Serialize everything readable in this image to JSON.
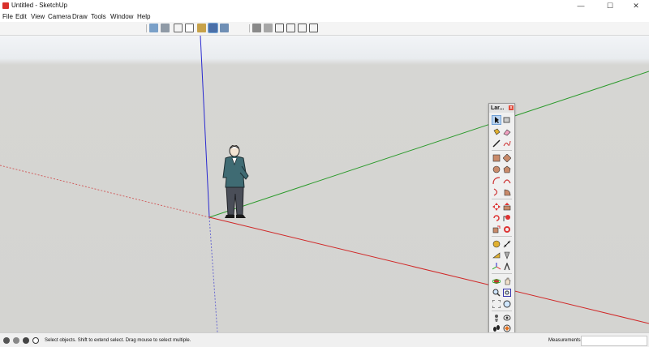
{
  "window": {
    "title": "Untitled - SketchUp",
    "controls": {
      "minimize": "—",
      "maximize": "☐",
      "close": "✕"
    }
  },
  "menu": [
    "File",
    "Edit",
    "View",
    "Camera",
    "Draw",
    "Tools",
    "Window",
    "Help"
  ],
  "toolbar": {
    "view_buttons": [
      {
        "icon": "iso-view-icon"
      },
      {
        "icon": "top-view-icon"
      },
      {
        "icon": "front-view-icon"
      },
      {
        "icon": "right-view-icon"
      },
      {
        "icon": "back-view-icon"
      },
      {
        "icon": "left-view-icon"
      }
    ],
    "style_buttons": [
      {
        "icon": "xray-style-icon"
      },
      {
        "icon": "back-edges-style-icon"
      },
      {
        "icon": "wireframe-style-icon"
      },
      {
        "icon": "hidden-line-style-icon"
      },
      {
        "icon": "shaded-style-icon"
      },
      {
        "icon": "shaded-textures-style-icon"
      }
    ]
  },
  "panel": {
    "title": "Lar...",
    "close_glyph": "x",
    "tools": [
      [
        "select-tool-icon",
        "component-tool-icon"
      ],
      [
        "paint-bucket-icon",
        "eraser-icon"
      ],
      [
        "line-tool-icon",
        "freehand-tool-icon"
      ],
      [
        "rectangle-tool-icon",
        "rotated-rectangle-icon"
      ],
      [
        "circle-tool-icon",
        "polygon-tool-icon"
      ],
      [
        "arc-tool-icon",
        "two-point-arc-icon"
      ],
      [
        "three-point-arc-icon",
        "pie-tool-icon"
      ],
      [
        "move-tool-icon",
        "push-pull-icon"
      ],
      [
        "rotate-tool-icon",
        "follow-me-icon"
      ],
      [
        "scale-tool-icon",
        "offset-tool-icon"
      ],
      [
        "tape-measure-icon",
        "dimension-tool-icon"
      ],
      [
        "protractor-icon",
        "text-tool-icon"
      ],
      [
        "axes-tool-icon",
        "3d-text-icon"
      ],
      [
        "orbit-tool-icon",
        "pan-tool-icon"
      ],
      [
        "zoom-tool-icon",
        "zoom-window-icon"
      ],
      [
        "zoom-extents-icon",
        "previous-view-icon"
      ],
      [
        "position-camera-icon",
        "look-around-icon"
      ],
      [
        "walk-tool-icon",
        "section-plane-icon"
      ]
    ]
  },
  "status": {
    "text": "Select objects. Shift to extend select. Drag mouse to select multiple.",
    "measurements_label": "Measurements",
    "measurements_value": ""
  }
}
